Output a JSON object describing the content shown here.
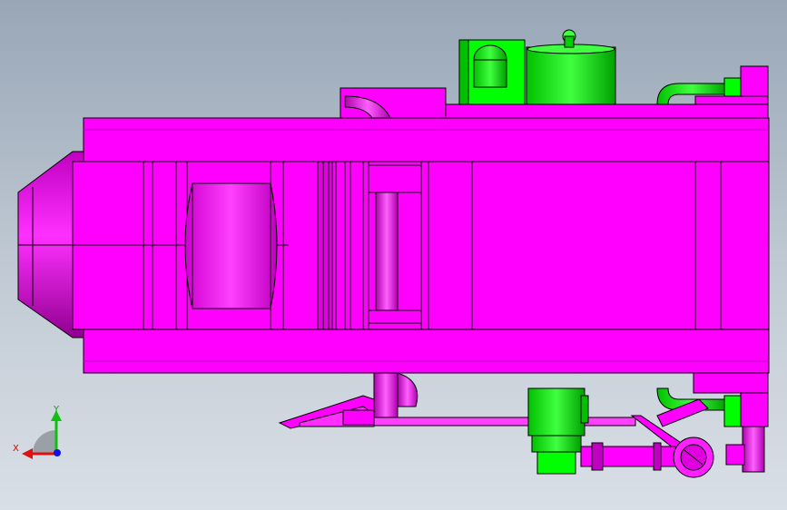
{
  "viewport": {
    "background_top": "#98a6b6",
    "background_bottom": "#d9dfe6"
  },
  "model": {
    "colors": {
      "main_body": "#ff00ff",
      "main_body_shadow": "#a000a0",
      "accessory": "#00ff00",
      "accessory_shadow": "#008800",
      "edge": "#000000"
    }
  },
  "triad": {
    "x_label": "X",
    "y_label": "Y",
    "x_color": "#e01010",
    "y_color": "#10c010",
    "z_color": "#1010e0"
  }
}
